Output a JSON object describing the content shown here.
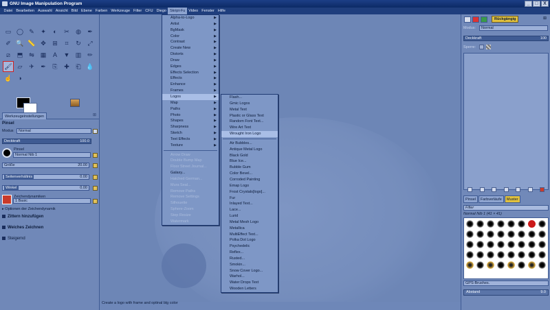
{
  "window": {
    "title": "GNU Image Manipulation Program",
    "buttons": [
      "_",
      "□",
      "X"
    ]
  },
  "menubar": [
    "Datei",
    "Bearbeiten",
    "Auswahl",
    "Ansicht",
    "Bild",
    "Ebene",
    "Farben",
    "Werkzeuge",
    "Filter",
    "CFU",
    "Diego",
    "Skript-Fu",
    "Video",
    "Fenster",
    "Hilfe"
  ],
  "menubar_active": "Skript-Fu",
  "tool_icons": [
    "rect-select-icon",
    "ellipse-select-icon",
    "free-select-icon",
    "fuzzy-select-icon",
    "color-select-icon",
    "scissors-select-icon",
    "foreground-select-icon",
    "paths-icon",
    "color-picker-icon",
    "zoom-icon",
    "measure-icon",
    "move-icon",
    "align-icon",
    "crop-icon",
    "rotate-icon",
    "scale-icon",
    "shear-icon",
    "perspective-icon",
    "flip-icon",
    "cage-icon",
    "text-icon",
    "bucket-fill-icon",
    "blend-icon",
    "pencil-icon",
    "paintbrush-icon",
    "eraser-icon",
    "airbrush-icon",
    "ink-icon",
    "clone-icon",
    "heal-icon",
    "perspective-clone-icon",
    "blur-icon",
    "smudge-icon",
    "dodge-burn-icon"
  ],
  "tool_glyphs": [
    "▭",
    "◯",
    "✎",
    "✦",
    "◐",
    "✂",
    "◍",
    "✒",
    "✐",
    "🔍",
    "📏",
    "✥",
    "⊞",
    "⌗",
    "↻",
    "⤢",
    "⧄",
    "⬒",
    "⇋",
    "▦",
    "A",
    "▼",
    "▥",
    "✏",
    "🖌",
    "▱",
    "✈",
    "✒",
    "⎘",
    "✚",
    "⎗",
    "💧",
    "☝",
    "◑"
  ],
  "left_panel": {
    "tab_label": "Werkzeugeinstellungen",
    "tool_name": "Pinsel",
    "modus_label": "Modus",
    "modus_value": "Normal",
    "deckkraft_label": "Deckkraft",
    "deckkraft_value": "100.0",
    "deckkraft_fraction": 1.0,
    "pinsel_label": "Pinsel",
    "pinsel_value": "Normal Nib 1",
    "groesse_label": "Größe",
    "groesse_value": "20.00",
    "seitenverhaeltnis_label": "Seitenverhältnis",
    "seitenverhaeltnis_value": "0.00",
    "winkel_label": "Winkel",
    "winkel_value": "0.00",
    "zeichendynamiken_label": "Zeichendynamiken",
    "zeichendynamiken_value": "1 Basic",
    "optionen_label": "Optionen der Zeichendynamik",
    "zittern_label": "Zittern hinzufügen",
    "weiches_label": "Weiches Zeichnen",
    "steigernd_label": "Steigernd"
  },
  "right_panel": {
    "undo_label": "Rückgängig",
    "modus_label": "Modus:",
    "modus_value": "Normal",
    "deckkraft_label": "Deckkraft",
    "deckkraft_value": "100",
    "sperre_label": "Sperre:",
    "tab_pinsel": "Pinsel",
    "tab_farbverlaeufe": "Farbverläufe",
    "tab_muster": "Muster",
    "filter_label": "Filter",
    "brush_name": "Normal Nib 1 (41 × 41)",
    "brush_set": "GPS-Brushes.",
    "abstand_label": "Abstand",
    "abstand_value": "9.0"
  },
  "menu_scriptfu": [
    {
      "label": "Alpha-to-Logo",
      "sub": true
    },
    {
      "label": "Artist",
      "sub": true
    },
    {
      "label": "BgMask",
      "sub": true
    },
    {
      "label": "Color",
      "sub": true
    },
    {
      "label": "Contrast",
      "sub": true
    },
    {
      "label": "Create New",
      "sub": true
    },
    {
      "label": "Distorts",
      "sub": true
    },
    {
      "label": "Draw",
      "sub": true
    },
    {
      "label": "Edges",
      "sub": true
    },
    {
      "label": "Effects Selection",
      "sub": true
    },
    {
      "label": "Effects",
      "sub": true
    },
    {
      "label": "Enhance",
      "sub": true
    },
    {
      "label": "Frames",
      "sub": true
    },
    {
      "label": "Logos",
      "sub": true,
      "highlight": true
    },
    {
      "label": "Map",
      "sub": true
    },
    {
      "label": "Paths",
      "sub": true
    },
    {
      "label": "Photo",
      "sub": true
    },
    {
      "label": "Shapes",
      "sub": true
    },
    {
      "label": "Sharpness",
      "sub": true
    },
    {
      "label": "Sketch",
      "sub": true
    },
    {
      "label": "Text Effects",
      "sub": true
    },
    {
      "label": "Texture",
      "sub": true
    },
    {
      "separator": true
    },
    {
      "label": "Arrow Draw",
      "disabled": true
    },
    {
      "label": "Double Bump Map",
      "disabled": true
    },
    {
      "label": "Floor Street Journal...",
      "disabled": true
    },
    {
      "label": "Galaxy..."
    },
    {
      "label": "Hatched German...",
      "disabled": true
    },
    {
      "label": "Mura Seal...",
      "disabled": true
    },
    {
      "label": "Remove Paths",
      "disabled": true
    },
    {
      "label": "Remove Settings",
      "disabled": true
    },
    {
      "label": "Silhouette",
      "disabled": true
    },
    {
      "label": "Sphere-Zoom",
      "disabled": true
    },
    {
      "label": "Step Resize",
      "disabled": true
    },
    {
      "label": "Watermark",
      "disabled": true
    }
  ],
  "menu_logos": [
    {
      "label": "Flash..."
    },
    {
      "label": "Gmic Logos"
    },
    {
      "label": "Metal Text"
    },
    {
      "label": "Plastic or Glass Text"
    },
    {
      "label": "Random Font Text..."
    },
    {
      "label": "Wire Art Text"
    },
    {
      "label": "Wrought Iron Logo",
      "highlight": true
    },
    {
      "separator": true
    },
    {
      "label": "Air Bubbles..."
    },
    {
      "label": "Antique Metal Logo"
    },
    {
      "label": "Black Gold"
    },
    {
      "label": "Blue Ice..."
    },
    {
      "label": "Bubble Gum"
    },
    {
      "label": "Color Bevel..."
    },
    {
      "label": "Corroded Painting"
    },
    {
      "label": "Emap Logo"
    },
    {
      "label": "Frost Crystals[logo]..."
    },
    {
      "label": "Fur"
    },
    {
      "label": "Inlayed Text..."
    },
    {
      "label": "Lace..."
    },
    {
      "label": "Lurid"
    },
    {
      "label": "Metal Mesh Logo"
    },
    {
      "label": "Metallica"
    },
    {
      "label": "MultiEffect Text..."
    },
    {
      "label": "Polka Dot Logo"
    },
    {
      "label": "Psychedelic"
    },
    {
      "label": "Reflex..."
    },
    {
      "label": "Rusted..."
    },
    {
      "label": "Smokin..."
    },
    {
      "label": "Snow Cover Logo..."
    },
    {
      "label": "Warhol..."
    },
    {
      "label": "Water Drops Text"
    },
    {
      "label": "Wooden Letters"
    }
  ],
  "status_text": "Create a logo with frame and optinal blg color",
  "colors": {
    "titlebar": "#0c2a66",
    "workspace": "#6d86b6",
    "menu_bg": "#7e97c6",
    "highlight": "#a9bee6"
  }
}
